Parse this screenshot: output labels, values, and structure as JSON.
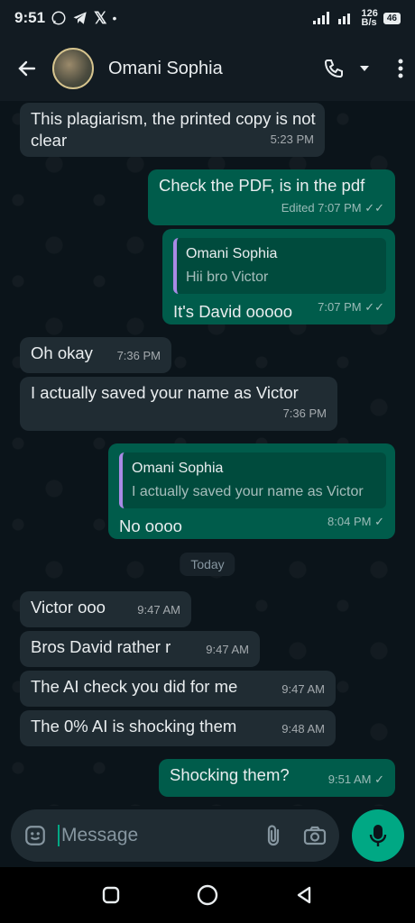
{
  "status": {
    "time": "9:51",
    "net_speed_top": "126",
    "net_speed_unit": "B/s",
    "battery": "46"
  },
  "header": {
    "contact_name": "Omani Sophia"
  },
  "messages": [
    {
      "text": "This plagiarism, the printed copy is not clear",
      "time": "5:23 PM"
    },
    {
      "text": "Check the PDF, is in the pdf",
      "time": "Edited 7:07 PM"
    },
    {
      "quote_name": "Omani Sophia",
      "quote_text": "Hii bro Victor",
      "text": "It's David ooooo",
      "time": "7:07 PM"
    },
    {
      "text": "Oh okay",
      "time": "7:36 PM"
    },
    {
      "text": "I actually saved your name as Victor",
      "time": "7:36 PM"
    },
    {
      "quote_name": "Omani Sophia",
      "quote_text": "I actually saved your name as Victor",
      "text": "No oooo",
      "time": "8:04 PM"
    },
    {
      "text": "Victor ooo",
      "time": "9:47 AM"
    },
    {
      "text": "Bros David rather r",
      "time": "9:47 AM"
    },
    {
      "text": "The AI check you did for me",
      "time": "9:47 AM"
    },
    {
      "text": "The 0% AI is shocking them",
      "time": "9:48 AM"
    },
    {
      "text": "Shocking them?",
      "time": "9:51 AM"
    }
  ],
  "date_separator": "Today",
  "composer": {
    "placeholder": "Message"
  },
  "colors": {
    "incoming": "#202c33",
    "outgoing": "#005c4b",
    "accent": "#00a884"
  }
}
